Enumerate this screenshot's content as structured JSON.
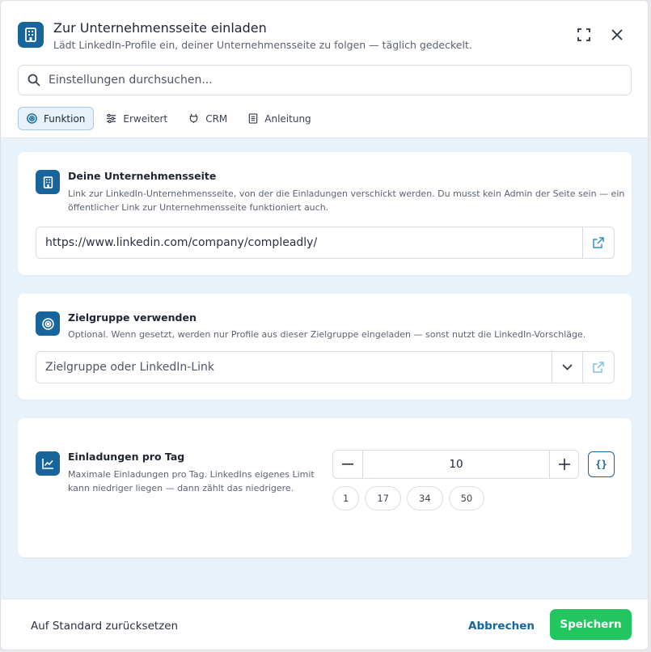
{
  "header": {
    "title": "Zur Unternehmensseite einladen",
    "subtitle": "Lädt LinkedIn-Profile ein, deiner Unternehmensseite zu folgen — täglich gedeckelt."
  },
  "search": {
    "placeholder": "Einstellungen durchsuchen..."
  },
  "tabs": [
    {
      "label": "Funktion",
      "icon": "target-icon",
      "active": true
    },
    {
      "label": "Erweitert",
      "icon": "sliders-icon",
      "active": false
    },
    {
      "label": "CRM",
      "icon": "plug-icon",
      "active": false
    },
    {
      "label": "Anleitung",
      "icon": "document-icon",
      "active": false
    }
  ],
  "company_page": {
    "title": "Deine Unternehmensseite",
    "description_1": "Link zur LinkedIn-Unternehmensseite, von der die Einladungen verschickt werden. Du musst kein Admin der Seite sein — ein",
    "description_2": "öffentlicher Link zur Unternehmensseite funktioniert auch.",
    "value": "https://www.linkedin.com/company/compleadly/"
  },
  "audience": {
    "title": "Zielgruppe verwenden",
    "description": "Optional. Wenn gesetzt, werden nur Profile aus dieser Zielgruppe eingeladen — sonst nutzt die LinkedIn-Vorschläge.",
    "placeholder": "Zielgruppe oder LinkedIn-Link"
  },
  "invites_per_day": {
    "title": "Einladungen pro Tag",
    "description_1": "Maximale Einladungen pro Tag. LinkedIns eigenes Limit",
    "description_2": "kann niedriger liegen — dann zählt das niedrigere.",
    "value": "10",
    "minus": "−",
    "plus": "+",
    "variable_label": "{}",
    "presets": [
      "1",
      "17",
      "34",
      "50"
    ]
  },
  "footer": {
    "reset_label": "Auf Standard zurücksetzen",
    "cancel_label": "Abbrechen",
    "save_label": "Speichern"
  },
  "colors": {
    "accent": "#17659a",
    "save": "#22c55e",
    "body_bg": "#e8f2fb"
  }
}
